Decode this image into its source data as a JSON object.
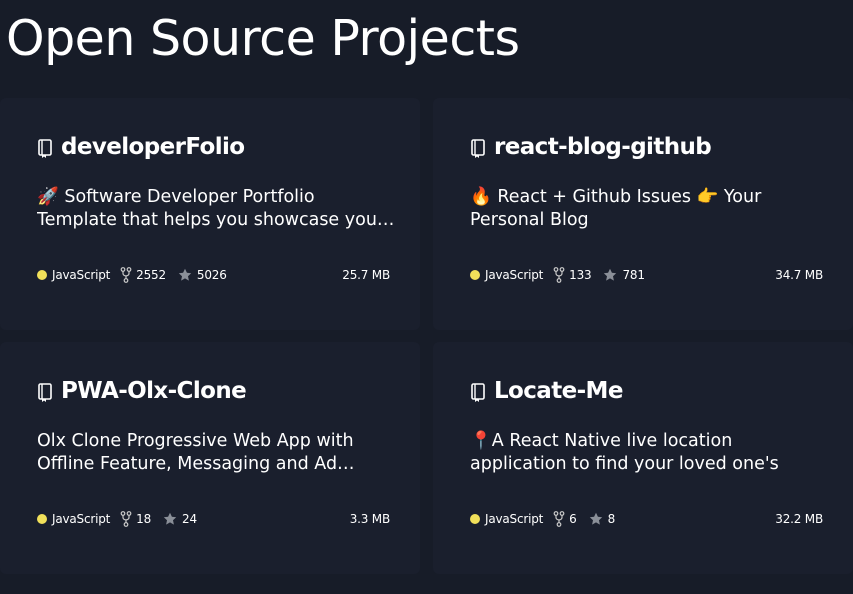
{
  "section": {
    "title": "Open Source Projects"
  },
  "projects": [
    {
      "name": "developerFolio",
      "description": "🚀 Software Developer Portfolio Template that helps you showcase your work and skills as a software developer.",
      "language": "JavaScript",
      "language_color": "#f1e05a",
      "forks": "2552",
      "stars": "5026",
      "size": "25.7 MB"
    },
    {
      "name": "react-blog-github",
      "description": "🔥 React + Github Issues 👉 Your Personal Blog",
      "language": "JavaScript",
      "language_color": "#f1e05a",
      "forks": "133",
      "stars": "781",
      "size": "34.7 MB"
    },
    {
      "name": "PWA-Olx-Clone",
      "description": "Olx Clone Progressive Web App with Offline Feature, Messaging and Ad Posting",
      "language": "JavaScript",
      "language_color": "#f1e05a",
      "forks": "18",
      "stars": "24",
      "size": "3.3 MB"
    },
    {
      "name": "Locate-Me",
      "description": "📍A React Native live location application to find your loved one's",
      "language": "JavaScript",
      "language_color": "#f1e05a",
      "forks": "6",
      "stars": "8",
      "size": "32.2 MB"
    }
  ],
  "icons": {
    "repo": "repo-book-icon",
    "fork": "fork-icon",
    "star": "star-icon",
    "language": "language-dot"
  }
}
